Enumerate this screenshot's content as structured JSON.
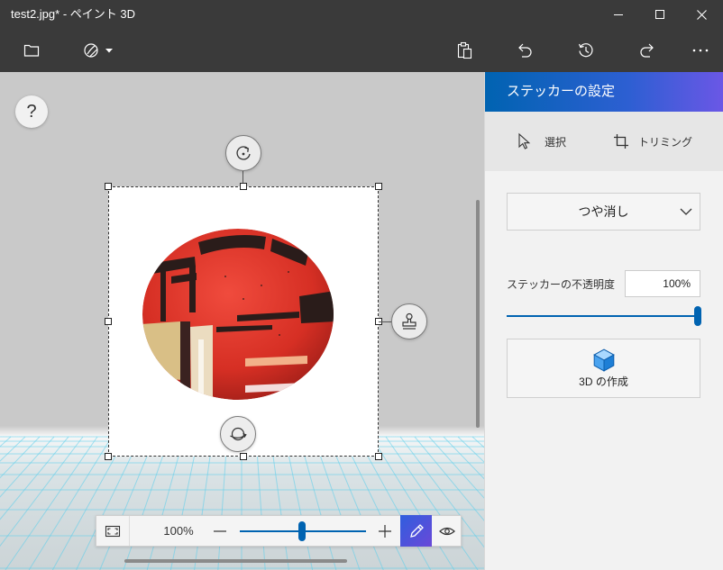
{
  "window": {
    "title": "test2.jpg* - ペイント 3D",
    "controls": [
      "minimize-icon",
      "maximize-icon",
      "close-icon"
    ]
  },
  "toolbar": {
    "left": [
      {
        "icon": "folder-icon"
      },
      {
        "icon": "sticker-tool-icon",
        "has_dropdown": true
      }
    ],
    "right": [
      {
        "icon": "paste-icon"
      },
      {
        "icon": "undo-icon"
      },
      {
        "icon": "history-icon"
      },
      {
        "icon": "redo-icon"
      },
      {
        "icon": "more-icon"
      }
    ]
  },
  "canvas": {
    "help_label": "?",
    "selection_tools": [
      "rotate-icon",
      "stamp-icon",
      "rotate-3d-icon"
    ]
  },
  "zoom": {
    "level_label": "100%",
    "slider_fraction": 0.49,
    "icons": [
      "fit-to-screen-icon",
      "zoom-out-icon",
      "zoom-in-icon",
      "pencil-icon",
      "eye-icon"
    ]
  },
  "panel": {
    "title": "ステッカーの設定",
    "tools": [
      {
        "label": "選択",
        "icon": "cursor-icon"
      },
      {
        "label": "トリミング",
        "icon": "crop-icon"
      }
    ],
    "finish": {
      "selected": "つや消し",
      "icon": "chevron-down-icon"
    },
    "opacity": {
      "label": "ステッカーの不透明度",
      "value_text": "100%",
      "value": 100
    },
    "make3d": {
      "label": "3D の作成",
      "icon": "cube-icon"
    }
  },
  "colors": {
    "titlebar": "#3a3a3a",
    "canvas": "#c9c9c9",
    "panel": "#f2f2f2",
    "accent": "#0063b1",
    "header_gradient_end": "#6b57e6",
    "sticker_red": "#d62f24",
    "grid_cyan": "#5acdeb"
  }
}
